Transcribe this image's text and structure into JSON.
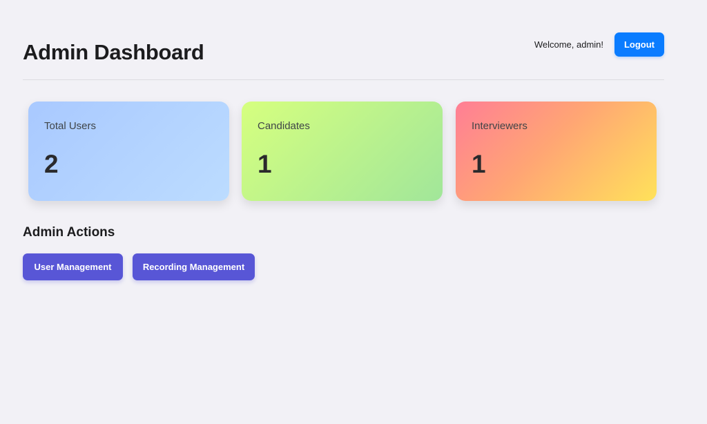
{
  "header": {
    "title": "Admin Dashboard",
    "welcome_text": "Welcome, admin!",
    "logout_label": "Logout"
  },
  "stats": [
    {
      "label": "Total Users",
      "value": "2"
    },
    {
      "label": "Candidates",
      "value": "1"
    },
    {
      "label": "Interviewers",
      "value": "1"
    }
  ],
  "admin_actions": {
    "title": "Admin Actions",
    "buttons": [
      {
        "label": "User Management"
      },
      {
        "label": "Recording Management"
      }
    ]
  },
  "colors": {
    "background": "#f2f1f6",
    "primary_button": "#0a7cff",
    "action_button": "#5856d6",
    "card_users": "#b4d3ff",
    "card_candidates": "#c1f08c",
    "card_interviewers": "#ffb07a"
  }
}
